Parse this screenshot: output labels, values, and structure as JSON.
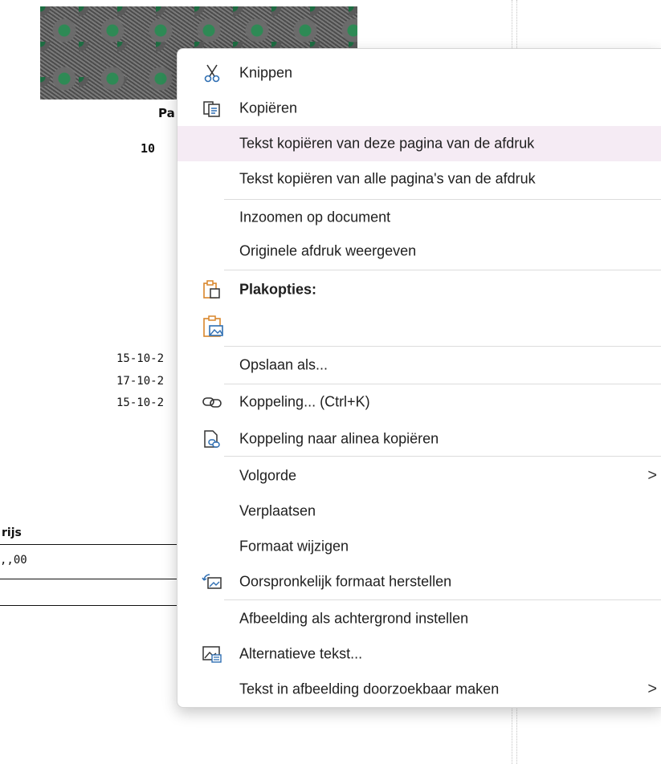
{
  "document": {
    "page_label": "Pa",
    "number_label": "10",
    "dates": [
      "15-10-2",
      "17-10-2",
      "15-10-2"
    ],
    "price_header": "rijs",
    "price_value": ",,00"
  },
  "context_menu": {
    "items": [
      {
        "label": "Knippen",
        "icon": "scissors-icon"
      },
      {
        "label": "Kopiëren",
        "icon": "copy-icon"
      },
      {
        "label": "Tekst kopiëren van deze pagina van de afdruk"
      },
      {
        "label": "Tekst kopiëren van alle pagina's van de afdruk"
      },
      {
        "label": "Inzoomen op document"
      },
      {
        "label": "Originele afdruk weergeven"
      },
      {
        "label": "Plakopties:",
        "icon": "clipboard-icon"
      },
      {
        "icon": "paste-as-picture-icon"
      },
      {
        "label": "Opslaan als..."
      },
      {
        "label": "Koppeling... (Ctrl+K)",
        "icon": "link-icon"
      },
      {
        "label": "Koppeling naar alinea kopiëren",
        "icon": "link-paragraph-icon"
      },
      {
        "label": "Volgorde",
        "submenu": ">"
      },
      {
        "label": "Verplaatsen"
      },
      {
        "label": "Formaat wijzigen"
      },
      {
        "label": "Oorspronkelijk formaat herstellen",
        "icon": "reset-size-icon"
      },
      {
        "label": "Afbeelding als achtergrond instellen"
      },
      {
        "label": "Alternatieve tekst...",
        "icon": "alt-text-icon"
      },
      {
        "label": "Tekst in afbeelding doorzoekbaar maken",
        "submenu": ">"
      }
    ]
  },
  "colors": {
    "highlight": "#f5ebf4",
    "icon_orange": "#d9862b",
    "icon_blue": "#2f6fb3"
  }
}
